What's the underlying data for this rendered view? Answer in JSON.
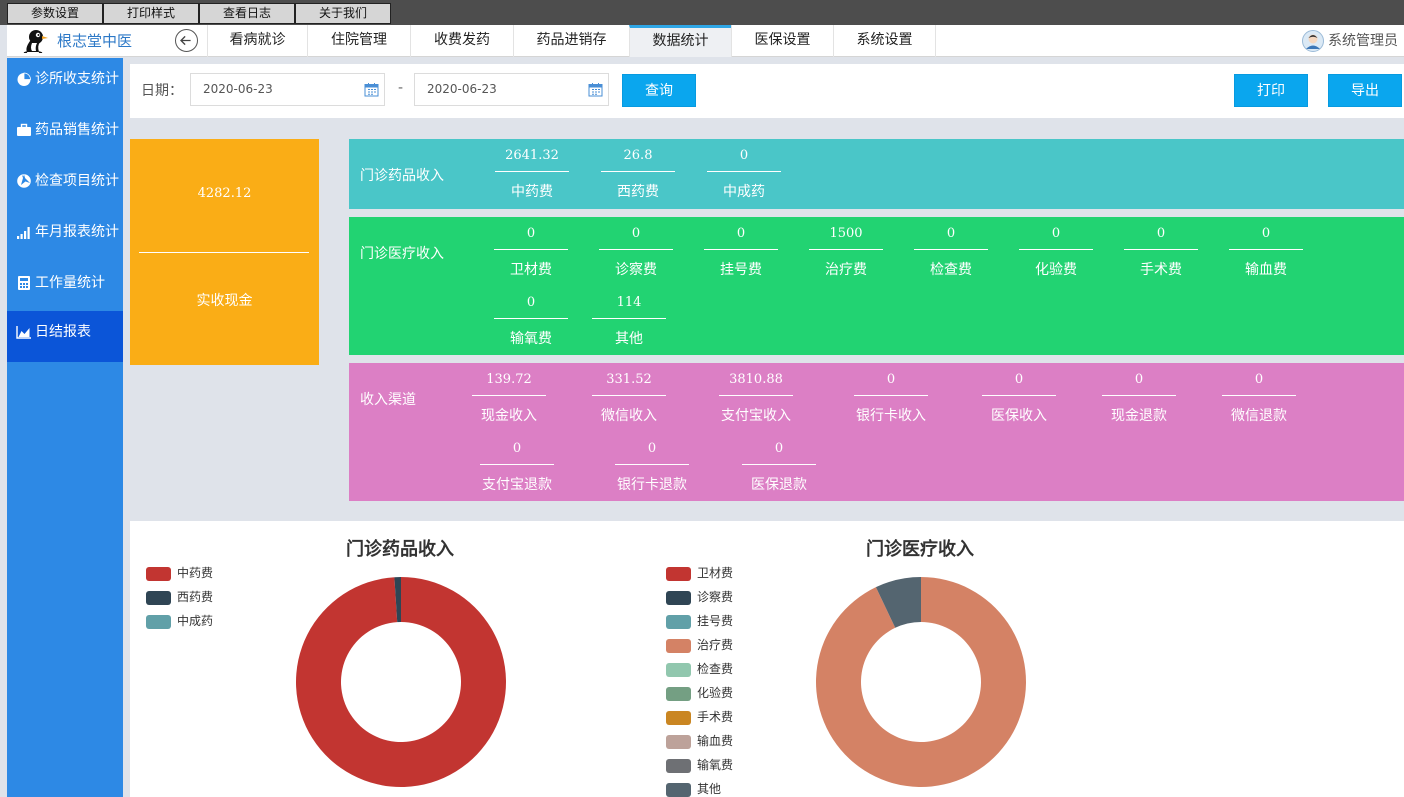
{
  "topmenu": [
    "参数设置",
    "打印样式",
    "查看日志",
    "关于我们"
  ],
  "brand": "根志堂中医",
  "tabs": [
    "看病就诊",
    "住院管理",
    "收费发药",
    "药品进销存",
    "数据统计",
    "医保设置",
    "系统设置"
  ],
  "active_tab": "数据统计",
  "user": "系统管理员",
  "sidebar": [
    {
      "label": "诊所收支统计",
      "icon": "pie-icon"
    },
    {
      "label": "药品销售统计",
      "icon": "briefcase-icon"
    },
    {
      "label": "检查项目统计",
      "icon": "aperture-icon"
    },
    {
      "label": "年月报表统计",
      "icon": "signal-bars-icon"
    },
    {
      "label": "工作量统计",
      "icon": "calculator-icon"
    },
    {
      "label": "日结报表",
      "icon": "area-chart-icon"
    }
  ],
  "filter": {
    "label": "日期：",
    "start_date": "2020-06-23",
    "separator": "-",
    "end_date": "2020-06-23",
    "query_label": "查询",
    "print_label": "打印",
    "export_label": "导出"
  },
  "cash": {
    "value": "4282.12",
    "label": "实收现金"
  },
  "drug_income": {
    "title": "门诊药品收入",
    "items": [
      {
        "value": "2641.32",
        "name": "中药费"
      },
      {
        "value": "26.8",
        "name": "西药费"
      },
      {
        "value": "0",
        "name": "中成药"
      }
    ]
  },
  "medical_income": {
    "title": "门诊医疗收入",
    "items": [
      {
        "value": "0",
        "name": "卫材费"
      },
      {
        "value": "0",
        "name": "诊察费"
      },
      {
        "value": "0",
        "name": "挂号费"
      },
      {
        "value": "1500",
        "name": "治疗费"
      },
      {
        "value": "0",
        "name": "检查费"
      },
      {
        "value": "0",
        "name": "化验费"
      },
      {
        "value": "0",
        "name": "手术费"
      },
      {
        "value": "0",
        "name": "输血费"
      },
      {
        "value": "0",
        "name": "输氧费"
      },
      {
        "value": "114",
        "name": "其他"
      }
    ]
  },
  "channels": {
    "title": "收入渠道",
    "items": [
      {
        "value": "139.72",
        "name": "现金收入"
      },
      {
        "value": "331.52",
        "name": "微信收入"
      },
      {
        "value": "3810.88",
        "name": "支付宝收入"
      },
      {
        "value": "0",
        "name": "银行卡收入"
      },
      {
        "value": "0",
        "name": "医保收入"
      },
      {
        "value": "0",
        "name": "现金退款"
      },
      {
        "value": "0",
        "name": "微信退款"
      },
      {
        "value": "0",
        "name": "支付宝退款"
      },
      {
        "value": "0",
        "name": "银行卡退款"
      },
      {
        "value": "0",
        "name": "医保退款"
      }
    ]
  },
  "colors": {
    "sidebar": "#2d89e5",
    "sidebar_active": "#0b55d8",
    "button": "#0aa6ee",
    "cash_card": "#faad16",
    "drug_band": "#4ac6c8",
    "medical_band": "#22d372",
    "channel_band": "#dc7fc5"
  },
  "chart_data": [
    {
      "type": "pie",
      "title": "门诊药品收入",
      "legend_position": "top-left",
      "categories": [
        "中药费",
        "西药费",
        "中成药"
      ],
      "values": [
        2641.32,
        26.8,
        0
      ],
      "colors": [
        "#c23531",
        "#2f4554",
        "#61a0a8"
      ]
    },
    {
      "type": "pie",
      "title": "门诊医疗收入",
      "legend_position": "top-left",
      "categories": [
        "卫材费",
        "诊察费",
        "挂号费",
        "治疗费",
        "检查费",
        "化验费",
        "手术费",
        "输血费",
        "输氧费",
        "其他"
      ],
      "values": [
        0,
        0,
        0,
        1500,
        0,
        0,
        0,
        0,
        0,
        114
      ],
      "colors": [
        "#c23531",
        "#2f4554",
        "#61a0a8",
        "#d48265",
        "#91c7ae",
        "#749f83",
        "#ca8622",
        "#bda29a",
        "#6e7074",
        "#546570"
      ]
    }
  ]
}
